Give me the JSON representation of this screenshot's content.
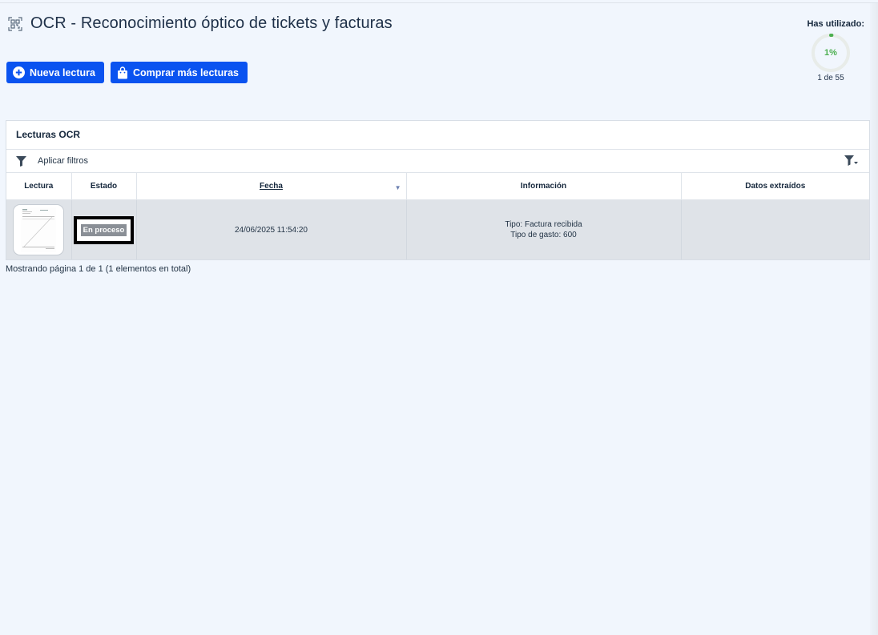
{
  "page": {
    "title": "OCR - Reconocimiento óptico de tickets y facturas"
  },
  "buttons": {
    "new_reading": "Nueva lectura",
    "buy_more": "Comprar más lecturas"
  },
  "usage": {
    "label": "Has utilizado:",
    "percent_text": "1%",
    "percent": 1,
    "count": "1 de 55",
    "gauge_color": "#4caf50"
  },
  "panel": {
    "title": "Lecturas OCR",
    "filter_label": "Aplicar filtros"
  },
  "table": {
    "columns": [
      "Lectura",
      "Estado",
      "Fecha",
      "Información",
      "Datos extraídos"
    ],
    "sorted_column": "Fecha",
    "rows": [
      {
        "status": "En proceso",
        "date": "24/06/2025 11:54:20",
        "info_line1": "Tipo: Factura recibida",
        "info_line2": "Tipo de gasto: 600",
        "extracted": ""
      }
    ]
  },
  "pagination": {
    "text": "Mostrando página 1 de 1 (1 elementos en total)"
  },
  "colors": {
    "primary": "#0a53f0",
    "status_badge": "#8a8f96",
    "row_background": "#dfe3e8",
    "page_background": "#f1f6fd"
  },
  "icons": {
    "header": "qr-scan-icon",
    "new_reading": "plus-circle-icon",
    "buy_more": "shopping-bag-icon",
    "filter": "filter-icon",
    "filter_right": "filter-options-icon"
  }
}
